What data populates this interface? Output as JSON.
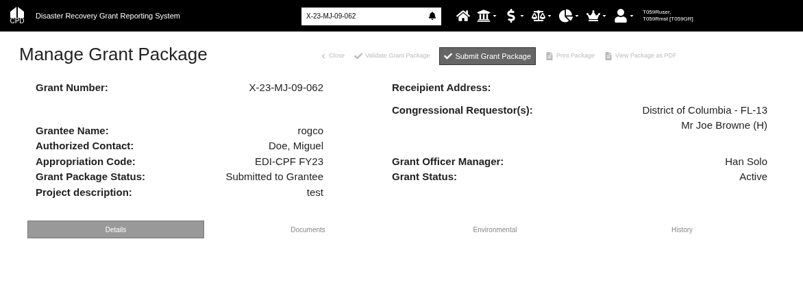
{
  "header": {
    "logo_text": "CPD",
    "app_title": "Disaster Recovery Grant Reporting System",
    "search": {
      "value": "X-23-MJ-09-062"
    },
    "user": "T059Ruser, T059Rmst [T059GR]"
  },
  "page_title": "Manage Grant Package",
  "toolbar": [
    {
      "label": "Close",
      "kind": "back",
      "primary": false
    },
    {
      "label": "Validate Grant Package",
      "kind": "check",
      "primary": false
    },
    {
      "label": "Submit Grant Package",
      "kind": "check",
      "primary": true
    },
    {
      "label": "Print Package",
      "kind": "doc",
      "primary": false
    },
    {
      "label": "View Package as PDF",
      "kind": "doc",
      "primary": false
    }
  ],
  "rows": [
    {
      "left": {
        "label": "Grant Number:",
        "value": "X-23-MJ-09-062"
      },
      "right": {
        "label": "Receipient Address:"
      }
    },
    {
      "left": {
        "label": "Grantee Name:",
        "value": "rogco"
      },
      "right": {
        "label": "Congressional Requestor(s):",
        "value": "District of Columbia - FL-13 Mr Joe Browne (H)"
      }
    },
    {
      "left": {
        "label": "Authorized Contact:",
        "value": "Doe, Miguel"
      }
    },
    {
      "left": {
        "label": "Appropriation Code:",
        "value": "EDI-CPF FY23"
      },
      "right": {
        "label": "Grant Officer Manager:",
        "value": "Han Solo"
      }
    },
    {
      "left": {
        "label": "Grant Package Status:",
        "value": "Submitted to Grantee"
      },
      "right": {
        "label": "Grant Status:",
        "value": "Active"
      }
    },
    {
      "left": {
        "label": "Project description:",
        "value": "test"
      }
    }
  ],
  "tabs": [
    {
      "label": "Details",
      "selected": true
    },
    {
      "label": "Documents",
      "selected": false
    },
    {
      "label": "Environmental",
      "selected": false
    },
    {
      "label": "History",
      "selected": false
    }
  ]
}
